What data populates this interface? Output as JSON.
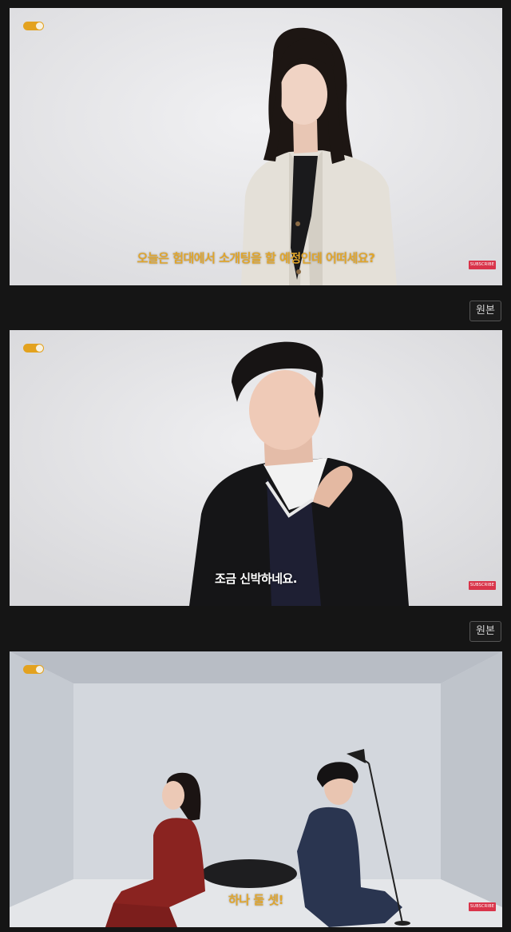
{
  "frames": [
    {
      "subtitle": "오늘은 험대에서 소개팅을 할 예정인데 어떠세요?",
      "badge": "SUBSCRIBE",
      "subtitle_color": "#e0a52c"
    },
    {
      "subtitle": "조금 신박하네요.",
      "badge": "SUBSCRIBE",
      "subtitle_color": "#ffffff"
    },
    {
      "subtitle": "하나 둘 셋!",
      "badge": "SUBSCRIBE",
      "subtitle_color": "#e0a52c"
    }
  ],
  "original_buttons": [
    "원본",
    "원본"
  ],
  "colors": {
    "background": "#151515",
    "toggle": "#e3a21f",
    "badge": "#d9344a"
  }
}
